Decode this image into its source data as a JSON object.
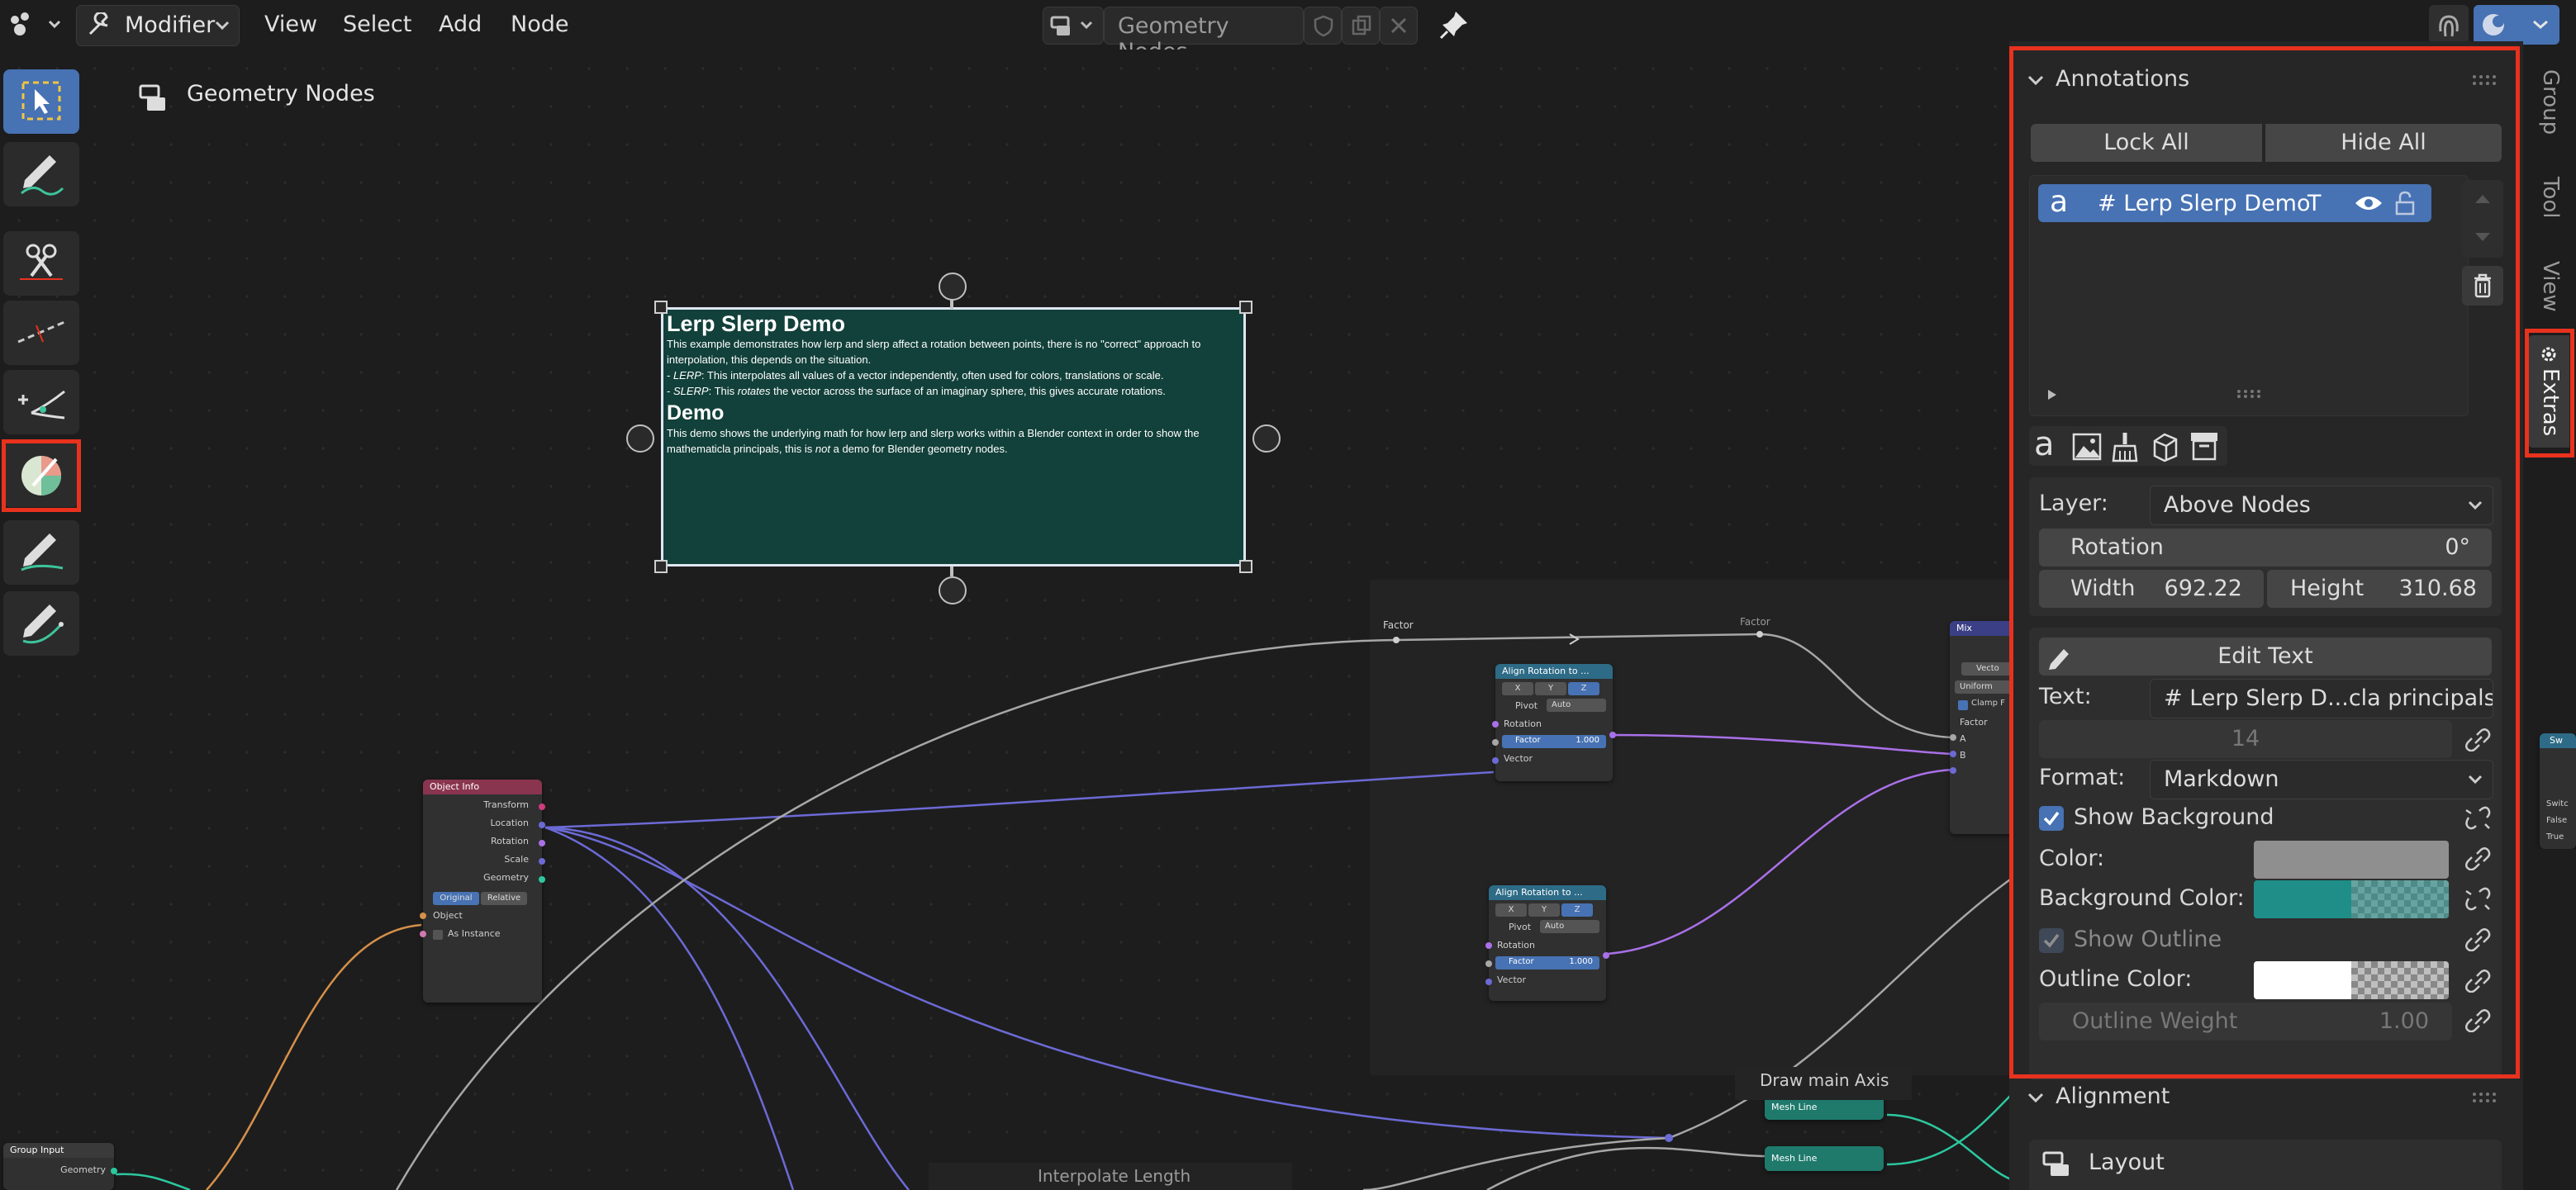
{
  "header": {
    "mode_label": "Modifier",
    "menus": [
      "View",
      "Select",
      "Add",
      "Node"
    ],
    "node_tree_name": "Geometry Nodes"
  },
  "canvas": {
    "breadcrumb": "Geometry Nodes",
    "note": {
      "h1": "Lerp Slerp Demo",
      "p1": "This example demonstrates how lerp and slerp affect a rotation between points, there is no \"correct\" approach to interpolation, this depends on the situation.",
      "li1_prefix": "- ",
      "li1_em": "LERP",
      "li1_text": ": This interpolates all values of a vector independently, often used for colors, translations or scale.",
      "li2_prefix": "- ",
      "li2_em": "SLERP",
      "li2_mid": ": This ",
      "li2_em2": "rotates",
      "li2_text": " the vector across the surface of an imaginary sphere, this gives accurate rotations.",
      "h2": "Demo",
      "p2_a": "This demo shows the underlying math for how lerp and slerp works within a Blender context in order to show the mathematicla principals, this is ",
      "p2_em": "not",
      "p2_b": " a demo for Blender geometry nodes."
    },
    "labels": {
      "factor1": "Factor",
      "factor2": "Factor",
      "draw_axis": "Draw main Axis",
      "interp_length": "Interpolate Length"
    },
    "object_info": {
      "title": "Object Info",
      "outputs": [
        "Transform",
        "Location",
        "Rotation",
        "Scale",
        "Geometry"
      ],
      "btn_original": "Original",
      "btn_relative": "Relative",
      "object": "Object",
      "as_instance": "As Instance"
    },
    "align1": {
      "title": "Align Rotation to ...",
      "x": "X",
      "y": "Y",
      "z": "Z",
      "pivot": "Pivot",
      "pivot_val": "Auto",
      "rotation": "Rotation",
      "factor": "Factor",
      "factor_val": "1.000",
      "vector": "Vector"
    },
    "align2": {
      "title": "Align Rotation to ...",
      "x": "X",
      "y": "Y",
      "z": "Z",
      "pivot": "Pivot",
      "pivot_val": "Auto",
      "rotation": "Rotation",
      "factor": "Factor",
      "factor_val": "1.000",
      "vector": "Vector"
    },
    "mix": {
      "title": "Mix",
      "vector": "Vecto",
      "uniform": "Uniform",
      "clamp": "Clamp F",
      "factor": "Factor",
      "a": "A",
      "b": "B"
    },
    "switch": {
      "title": "Sw",
      "switch": "Switc",
      "false": "False",
      "true": "True"
    },
    "mesh_line1": "Mesh Line",
    "mesh_line2": "Mesh Line",
    "group_input": {
      "title": "Group Input",
      "geometry": "Geometry"
    }
  },
  "panel": {
    "annotations_title": "Annotations",
    "lock_all": "Lock All",
    "hide_all": "Hide All",
    "list_item": "# Lerp Slerp Demo",
    "list_item_suffix": "T",
    "layer_label": "Layer:",
    "layer_value": "Above Nodes",
    "rotation_label": "Rotation",
    "rotation_value": "0°",
    "width_label": "Width",
    "width_value": "692.22",
    "height_label": "Height",
    "height_value": "310.68",
    "edit_text": "Edit Text",
    "text_label": "Text:",
    "text_value": "# Lerp Slerp D...cla principals,",
    "font_size": "14",
    "format_label": "Format:",
    "format_value": "Markdown",
    "show_background": "Show Background",
    "color_label": "Color:",
    "bg_color_label": "Background Color:",
    "show_outline": "Show Outline",
    "outline_color_label": "Outline Color:",
    "outline_weight_label": "Outline Weight",
    "outline_weight_value": "1.00",
    "alignment_title": "Alignment",
    "layout_label": "Layout"
  },
  "side_tabs": [
    "Group",
    "Tool",
    "View",
    "Extras"
  ],
  "colors": {
    "accent": "#4772b3",
    "highlight_box": "#e8321e",
    "note_background": "#12403a",
    "annotation_bg_color": "#1f8e88",
    "annotation_color": "#8f8f8f",
    "outline_color": "#ffffff"
  }
}
